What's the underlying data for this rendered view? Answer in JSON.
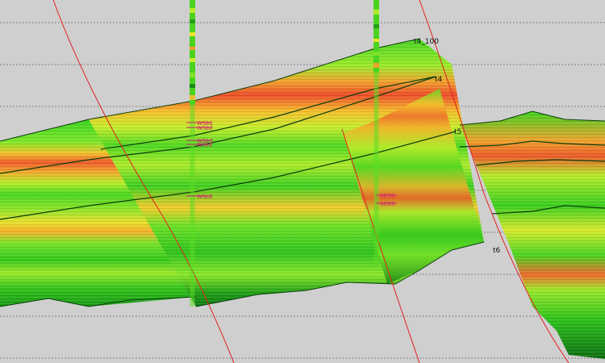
{
  "view": {
    "background": "#cfcfcf",
    "gridline_color": "#808080",
    "fault_color": "#e02020",
    "horizon_color": "#0b3d0b"
  },
  "palette": {
    "low": "#2fc81c",
    "mid_low": "#5fe626",
    "mid": "#c6ef2a",
    "mid_high": "#f3d22a",
    "high": "#f5a22e",
    "peak": "#ee5a2a"
  },
  "horizons": [
    {
      "id": "t4_100",
      "label": "t4_100"
    },
    {
      "id": "t4",
      "label": "t4"
    },
    {
      "id": "t5",
      "label": "t5"
    },
    {
      "id": "t6",
      "label": "t6"
    }
  ],
  "well_markers": {
    "well_a": [
      "WSb1",
      "WSb2",
      "WSb3",
      "WSc1",
      "WSc2"
    ],
    "well_b": [
      "SC76",
      "SC69"
    ]
  }
}
